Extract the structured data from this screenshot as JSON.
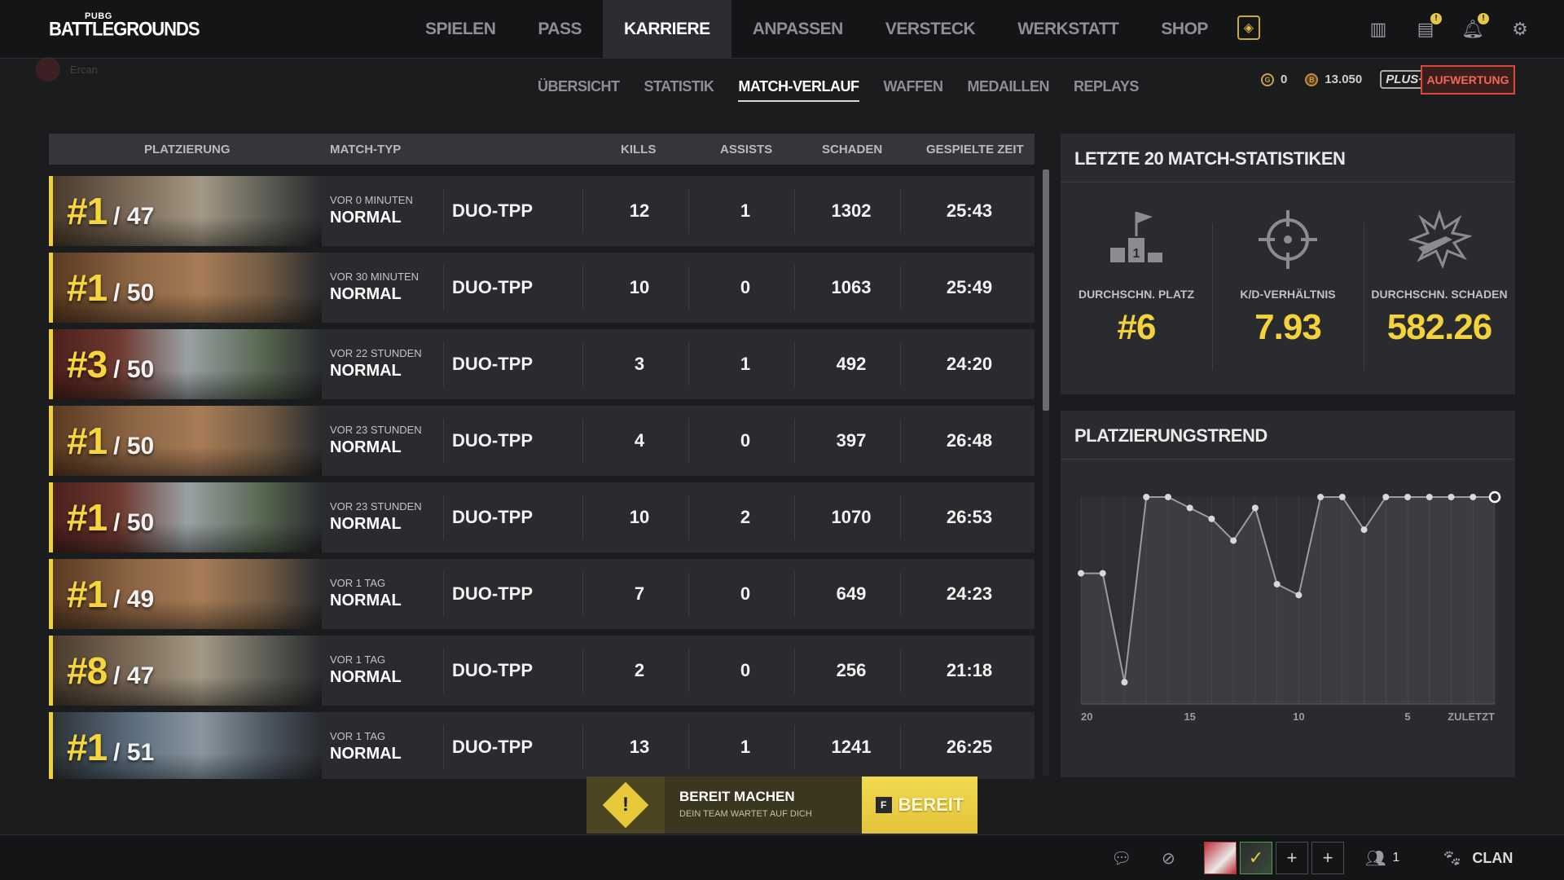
{
  "brand": {
    "small": "PUBG",
    "big": "BATTLEGROUNDS"
  },
  "user": {
    "name": "Ercan"
  },
  "main_nav": [
    {
      "label": "SPIELEN",
      "active": false
    },
    {
      "label": "PASS",
      "active": false
    },
    {
      "label": "KARRIERE",
      "active": true
    },
    {
      "label": "ANPASSEN",
      "active": false
    },
    {
      "label": "VERSTECK",
      "active": false
    },
    {
      "label": "WERKSTATT",
      "active": false
    },
    {
      "label": "SHOP",
      "active": false
    }
  ],
  "top_icons": [
    "storage-icon",
    "news-icon",
    "notifications-icon",
    "settings-icon"
  ],
  "sub_nav": [
    {
      "label": "ÜBERSICHT",
      "active": false
    },
    {
      "label": "STATISTIK",
      "active": false
    },
    {
      "label": "MATCH-VERLAUF",
      "active": true
    },
    {
      "label": "WAFFEN",
      "active": false
    },
    {
      "label": "MEDAILLEN",
      "active": false
    },
    {
      "label": "REPLAYS",
      "active": false
    }
  ],
  "currency": {
    "g_coin": "0",
    "bp": "13.050",
    "plus_label": "PLUS+",
    "upgrade_label": "AUFWERTUNG"
  },
  "table": {
    "headers": {
      "placement": "PLATZIERUNG",
      "match_type": "MATCH-TYP",
      "kills": "KILLS",
      "assists": "ASSISTS",
      "damage": "SCHADEN",
      "time": "GESPIELTE ZEIT"
    },
    "rows": [
      {
        "rank": "#1",
        "total": "/ 47",
        "ago": "VOR 0 MINUTEN",
        "mode": "NORMAL",
        "type": "DUO-TPP",
        "kills": "12",
        "assists": "1",
        "damage": "1302",
        "time": "25:43",
        "map": "erangel"
      },
      {
        "rank": "#1",
        "total": "/ 50",
        "ago": "VOR 30 MINUTEN",
        "mode": "NORMAL",
        "type": "DUO-TPP",
        "kills": "10",
        "assists": "0",
        "damage": "1063",
        "time": "25:49",
        "map": "miramar"
      },
      {
        "rank": "#3",
        "total": "/ 50",
        "ago": "VOR 22 STUNDEN",
        "mode": "NORMAL",
        "type": "DUO-TPP",
        "kills": "3",
        "assists": "1",
        "damage": "492",
        "time": "24:20",
        "map": "taego"
      },
      {
        "rank": "#1",
        "total": "/ 50",
        "ago": "VOR 23 STUNDEN",
        "mode": "NORMAL",
        "type": "DUO-TPP",
        "kills": "4",
        "assists": "0",
        "damage": "397",
        "time": "26:48",
        "map": "miramar"
      },
      {
        "rank": "#1",
        "total": "/ 50",
        "ago": "VOR 23 STUNDEN",
        "mode": "NORMAL",
        "type": "DUO-TPP",
        "kills": "10",
        "assists": "2",
        "damage": "1070",
        "time": "26:53",
        "map": "taego"
      },
      {
        "rank": "#1",
        "total": "/ 49",
        "ago": "VOR 1 TAG",
        "mode": "NORMAL",
        "type": "DUO-TPP",
        "kills": "7",
        "assists": "0",
        "damage": "649",
        "time": "24:23",
        "map": "miramar"
      },
      {
        "rank": "#8",
        "total": "/ 47",
        "ago": "VOR 1 TAG",
        "mode": "NORMAL",
        "type": "DUO-TPP",
        "kills": "2",
        "assists": "0",
        "damage": "256",
        "time": "21:18",
        "map": "erangel"
      },
      {
        "rank": "#1",
        "total": "/ 51",
        "ago": "VOR 1 TAG",
        "mode": "NORMAL",
        "type": "DUO-TPP",
        "kills": "13",
        "assists": "1",
        "damage": "1241",
        "time": "26:25",
        "map": "sanhok"
      }
    ]
  },
  "stats_panel": {
    "title": "LETZTE 20 MATCH-STATISTIKEN",
    "items": [
      {
        "label": "DURCHSCHN. PLATZ",
        "value": "#6",
        "icon": "podium-icon"
      },
      {
        "label": "K/D-VERHÄLTNIS",
        "value": "7.93",
        "icon": "crosshair-icon"
      },
      {
        "label": "DURCHSCHN. SCHADEN",
        "value": "582.26",
        "icon": "bullet-impact-icon"
      }
    ]
  },
  "trend_panel": {
    "title": "PLATZIERUNGSTREND",
    "x_labels": [
      "20",
      "15",
      "10",
      "5",
      "ZULETZT"
    ]
  },
  "chart_data": {
    "type": "line",
    "title": "PLATZIERUNGSTREND",
    "x": [
      20,
      19,
      18,
      17,
      16,
      15,
      14,
      13,
      12,
      11,
      10,
      9,
      8,
      7,
      6,
      5,
      4,
      3,
      2,
      1
    ],
    "x_tick_labels": [
      "20",
      "15",
      "10",
      "5",
      "ZULETZT"
    ],
    "series": [
      {
        "values": [
          8,
          8,
          18,
          1,
          1,
          2,
          3,
          5,
          2,
          9,
          10,
          1,
          1,
          4,
          1,
          1,
          1,
          1,
          1,
          1
        ]
      }
    ],
    "y_inverted": true,
    "ylim": [
      1,
      20
    ],
    "grid": true,
    "colors": {
      "line": "#9a9ca0",
      "point": "#d8d8d8",
      "last_point": "#ffffff"
    }
  },
  "ready_bar": {
    "title": "BEREIT MACHEN",
    "subtitle": "DEIN TEAM WARTET AUF DICH",
    "key": "F",
    "button": "BEREIT"
  },
  "bottom_bar": {
    "friends_count": "1",
    "friends_badge": "1",
    "clan_label": "CLAN"
  },
  "colors": {
    "accent_yellow": "#f4d23c",
    "upgrade_red": "#d64a3a"
  }
}
